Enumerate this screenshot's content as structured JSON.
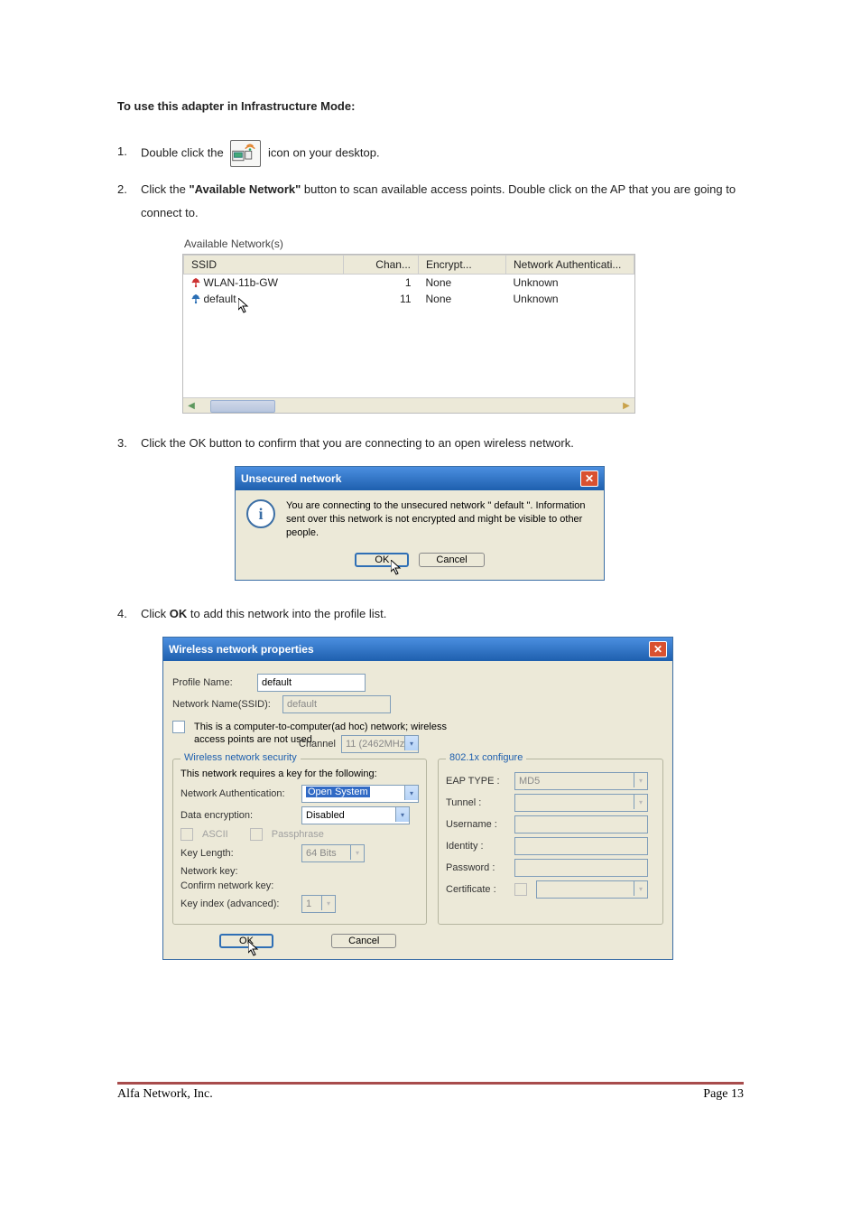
{
  "title": "To use this adapter in Infrastructure Mode:",
  "steps": {
    "s1_pre": "Double click the",
    "s1_post": "icon on your desktop.",
    "s2_pre": "Click the ",
    "s2_bold": "\"Available Network\"",
    "s2_post": " button to scan available access points. Double click on the AP that you are going to connect to.",
    "s3": "Click the OK button to confirm that you are connecting to an open wireless network.",
    "s4_pre": "Click ",
    "s4_bold": "OK",
    "s4_post": " to add this network into the profile list."
  },
  "avail": {
    "caption": "Available Network(s)",
    "cols": {
      "ssid": "SSID",
      "chan": "Chan...",
      "encrypt": "Encrypt...",
      "auth": "Network Authenticati..."
    },
    "rows": [
      {
        "ssid": "WLAN-11b-GW",
        "chan": "1",
        "encrypt": "None",
        "auth": "Unknown",
        "color": "red"
      },
      {
        "ssid": "default",
        "chan": "11",
        "encrypt": "None",
        "auth": "Unknown",
        "color": "blue"
      }
    ]
  },
  "unsecured": {
    "title": "Unsecured network",
    "msg": "You are connecting to the unsecured network \" default \". Information sent over this network is not encrypted and might be visible to other people.",
    "ok": "OK",
    "cancel": "Cancel"
  },
  "wnp": {
    "title": "Wireless network properties",
    "profile_name_label": "Profile Name:",
    "profile_name": "default",
    "ssid_label": "Network Name(SSID):",
    "ssid": "default",
    "adhoc": "This is a computer-to-computer(ad hoc) network; wireless access points are not used.",
    "channel_label": "Channel",
    "channel": "11 (2462MHz)",
    "sec_group": "Wireless network security",
    "sec_note": "This network requires a key for the following:",
    "net_auth_label": "Network Authentication:",
    "net_auth": "Open System",
    "data_enc_label": "Data encryption:",
    "data_enc": "Disabled",
    "ascii": "ASCII",
    "passphrase": "Passphrase",
    "key_len_label": "Key Length:",
    "key_len": "64 Bits",
    "net_key_label": "Network key:",
    "confirm_key_label": "Confirm network key:",
    "key_index_label": "Key index (advanced):",
    "key_index": "1",
    "eap_group": "802.1x configure",
    "eap_type_label": "EAP TYPE :",
    "eap_type": "MD5",
    "tunnel_label": "Tunnel :",
    "username_label": "Username :",
    "identity_label": "Identity :",
    "password_label": "Password :",
    "cert_label": "Certificate :",
    "ok": "OK",
    "cancel": "Cancel"
  },
  "footer": {
    "company": "Alfa Network, Inc.",
    "page": "Page 13"
  }
}
